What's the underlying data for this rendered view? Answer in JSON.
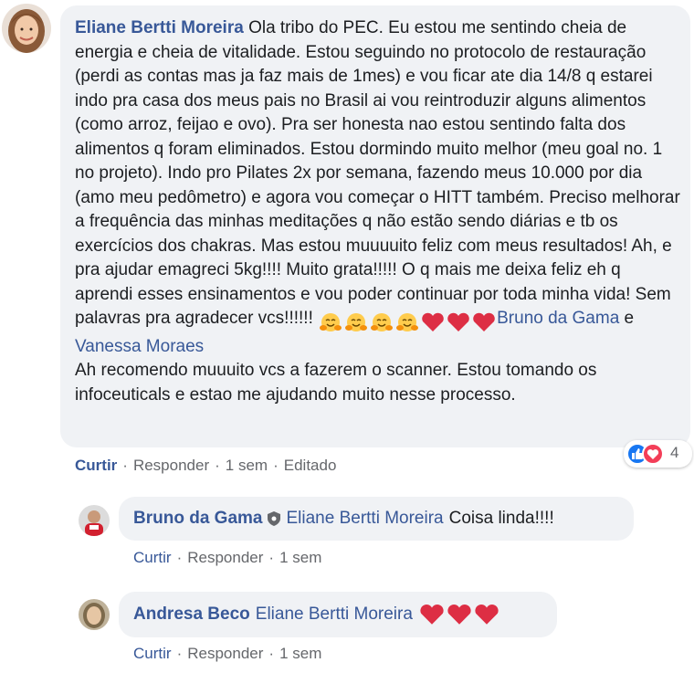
{
  "main_comment": {
    "author": "Eliane Bertti Moreira",
    "text": "Ola tribo do PEC. Eu estou me sentindo cheia de energia e cheia de vitalidade. Estou seguindo no protocolo de restauração (perdi as contas mas ja faz mais de 1mes) e vou ficar ate dia 14/8 q estarei indo pra casa dos meus pais no Brasil ai vou reintroduzir alguns alimentos (como arroz, feijao e ovo). Pra ser honesta nao estou sentindo falta dos alimentos q foram eliminados. Estou dormindo muito melhor (meu goal no. 1 no projeto). Indo pro Pilates 2x por semana, fazendo meus 10.000 por dia (amo meu pedômetro) e agora vou começar o HITT também. Preciso melhorar a frequência das minhas meditações q não estão sendo diárias e tb os exercícios dos chakras. Mas estou muuuuito feliz com meus resultados! Ah, e pra ajudar emagreci 5kg!!!! Muito grata!!!!! O q mais me deixa feliz eh q aprendi esses ensinamentos e vou poder continuar por toda minha vida! Sem palavras pra agradecer vcs!!!!!!",
    "emoji_icons": [
      "hugging-face-emoji",
      "hugging-face-emoji",
      "hugging-face-emoji",
      "hugging-face-emoji",
      "red-heart-emoji",
      "red-heart-emoji",
      "red-heart-emoji"
    ],
    "mention_1": "Bruno da Gama",
    "conjunction": "e",
    "mention_2": "Vanessa Moraes",
    "text_2": "Ah recomendo muuuito vcs a fazerem o scanner. Estou tomando os infoceuticals e estao me ajudando muito nesse processo.",
    "actions": {
      "like": "Curtir",
      "reply": "Responder",
      "time": "1 sem",
      "edited": "Editado",
      "separator": "·"
    },
    "reactions": {
      "icons": [
        "like-icon",
        "love-icon"
      ],
      "count": "4",
      "like_color": "#1877f2",
      "love_color": "#f33e58"
    }
  },
  "replies": [
    {
      "author": "Bruno da Gama",
      "badge_icon": "shield-badge-icon",
      "mention": "Eliane Bertti Moreira",
      "text": "Coisa linda!!!!",
      "actions": {
        "like": "Curtir",
        "reply": "Responder",
        "time": "1 sem"
      }
    },
    {
      "author": "Andresa Beco",
      "mention": "Eliane Bertti Moreira",
      "emoji_icons": [
        "red-heart-emoji",
        "red-heart-emoji",
        "red-heart-emoji"
      ],
      "actions": {
        "like": "Curtir",
        "reply": "Responder",
        "time": "1 sem"
      }
    }
  ],
  "colors": {
    "link": "#385898",
    "bubble": "#f0f2f5",
    "meta": "#65676b",
    "text": "#1c1e21"
  }
}
